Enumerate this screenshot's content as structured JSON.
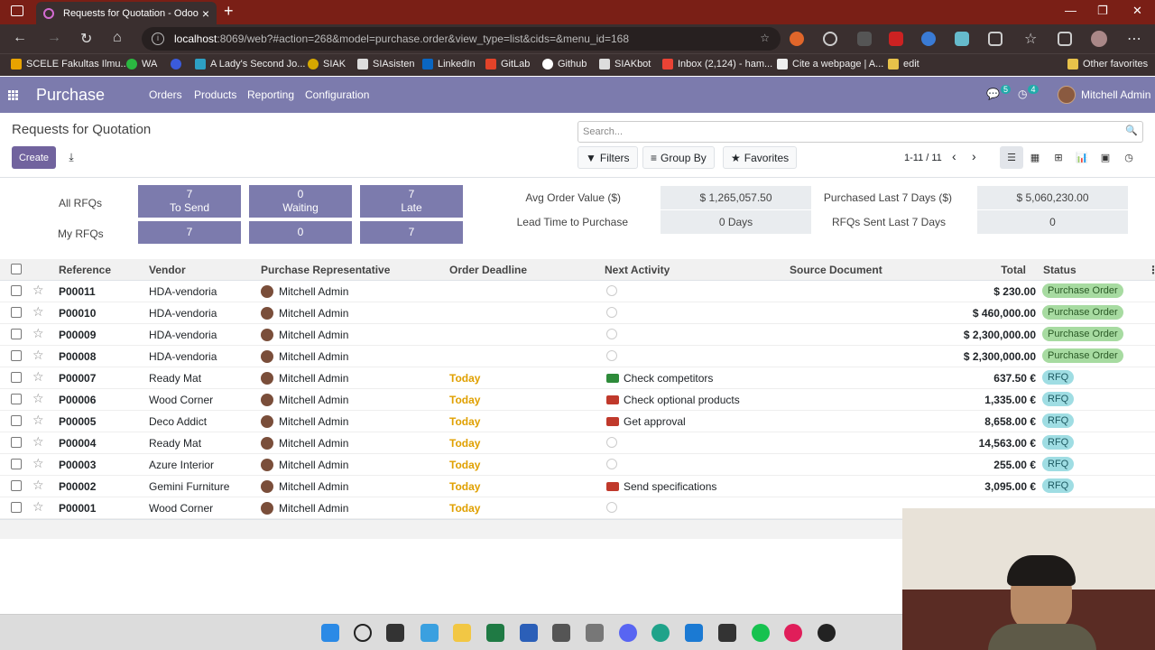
{
  "browser": {
    "tab_title": "Requests for Quotation - Odoo",
    "url_host": "localhost",
    "url_rest": ":8069/web?#action=268&model=purchase.order&view_type=list&cids=&menu_id=168",
    "bookmarks": [
      "SCELE Fakultas Ilmu...",
      "WA",
      "A Lady's Second Jo...",
      "SIAK",
      "SIAsisten",
      "LinkedIn",
      "GitLab",
      "Github",
      "SIAKbot",
      "Inbox (2,124) - ham...",
      "Cite a webpage | A...",
      "edit",
      "Other favorites"
    ]
  },
  "app": {
    "name": "Purchase",
    "menu": [
      "Orders",
      "Products",
      "Reporting",
      "Configuration"
    ],
    "messages_count": "5",
    "activities_count": "4",
    "user": "Mitchell Admin"
  },
  "control": {
    "breadcrumb": "Requests for Quotation",
    "create_label": "Create",
    "search_placeholder": "Search...",
    "filters": "Filters",
    "group_by": "Group By",
    "favorites": "Favorites",
    "pager": "1-11 / 11"
  },
  "dashboard": {
    "all_rfqs": "All RFQs",
    "my_rfqs": "My RFQs",
    "to_send_count": "7",
    "to_send_label": "To Send",
    "waiting_count": "0",
    "waiting_label": "Waiting",
    "late_count": "7",
    "late_label": "Late",
    "my_to_send": "7",
    "my_waiting": "0",
    "my_late": "7",
    "avg_order_label": "Avg Order Value ($)",
    "avg_order_value": "$ 1,265,057.50",
    "lead_time_label": "Lead Time to Purchase",
    "lead_time_value": "0  Days",
    "purchased_label": "Purchased Last 7 Days ($)",
    "purchased_value": "$ 5,060,230.00",
    "sent_label": "RFQs Sent Last 7 Days",
    "sent_value": "0"
  },
  "columns": {
    "reference": "Reference",
    "vendor": "Vendor",
    "rep": "Purchase Representative",
    "deadline": "Order Deadline",
    "activity": "Next Activity",
    "source": "Source Document",
    "total": "Total",
    "status": "Status"
  },
  "rows": [
    {
      "ref": "P00011",
      "vendor": "HDA-vendoria",
      "rep": "Mitchell Admin",
      "deadline": "",
      "activity": "",
      "total": "$ 230.00",
      "status": "Purchase Order"
    },
    {
      "ref": "P00010",
      "vendor": "HDA-vendoria",
      "rep": "Mitchell Admin",
      "deadline": "",
      "activity": "",
      "total": "$ 460,000.00",
      "status": "Purchase Order"
    },
    {
      "ref": "P00009",
      "vendor": "HDA-vendoria",
      "rep": "Mitchell Admin",
      "deadline": "",
      "activity": "",
      "total": "$ 2,300,000.00",
      "status": "Purchase Order"
    },
    {
      "ref": "P00008",
      "vendor": "HDA-vendoria",
      "rep": "Mitchell Admin",
      "deadline": "",
      "activity": "",
      "total": "$ 2,300,000.00",
      "status": "Purchase Order"
    },
    {
      "ref": "P00007",
      "vendor": "Ready Mat",
      "rep": "Mitchell Admin",
      "deadline": "Today",
      "activity": "Check competitors",
      "total": "637.50 €",
      "status": "RFQ"
    },
    {
      "ref": "P00006",
      "vendor": "Wood Corner",
      "rep": "Mitchell Admin",
      "deadline": "Today",
      "activity": "Check optional products",
      "total": "1,335.00 €",
      "status": "RFQ"
    },
    {
      "ref": "P00005",
      "vendor": "Deco Addict",
      "rep": "Mitchell Admin",
      "deadline": "Today",
      "activity": "Get approval",
      "total": "8,658.00 €",
      "status": "RFQ"
    },
    {
      "ref": "P00004",
      "vendor": "Ready Mat",
      "rep": "Mitchell Admin",
      "deadline": "Today",
      "activity": "",
      "total": "14,563.00 €",
      "status": "RFQ"
    },
    {
      "ref": "P00003",
      "vendor": "Azure Interior",
      "rep": "Mitchell Admin",
      "deadline": "Today",
      "activity": "",
      "total": "255.00 €",
      "status": "RFQ"
    },
    {
      "ref": "P00002",
      "vendor": "Gemini Furniture",
      "rep": "Mitchell Admin",
      "deadline": "Today",
      "activity": "Send specifications",
      "total": "3,095.00 €",
      "status": "RFQ"
    },
    {
      "ref": "P00001",
      "vendor": "Wood Corner",
      "rep": "Mitchell Admin",
      "deadline": "Today",
      "activity": "",
      "total": "",
      "status": ""
    }
  ]
}
